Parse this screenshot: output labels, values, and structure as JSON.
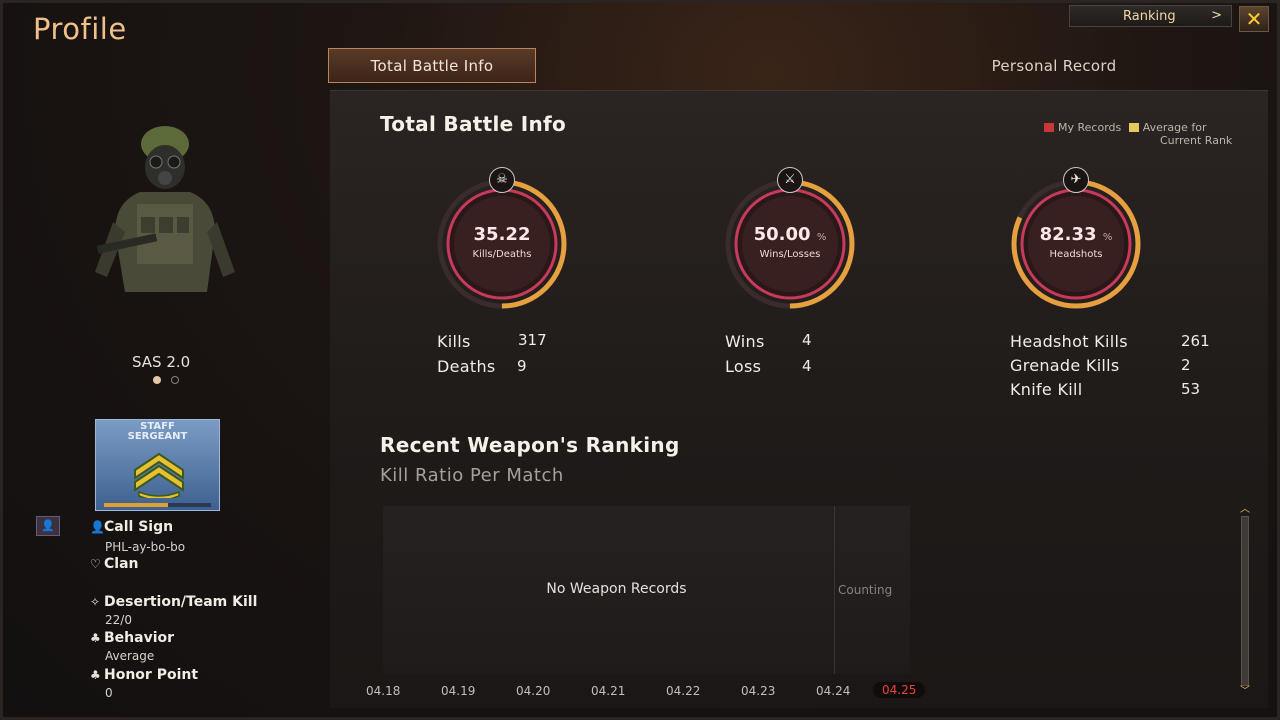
{
  "header": {
    "title": "Profile",
    "ranking_label": "Ranking",
    "ranking_arrow": ">",
    "close_symbol": "✕"
  },
  "tabs": [
    {
      "label": "Total Battle Info",
      "active": true
    },
    {
      "label": "Personal Record",
      "active": false
    }
  ],
  "character": {
    "name": "SAS 2.0",
    "page_count": 2,
    "current_page": 1
  },
  "rank": {
    "title_line1": "STAFF",
    "title_line2": "SERGEANT",
    "progress": 0.6
  },
  "player_info": {
    "call_sign_label": "Call Sign",
    "call_sign": "PHL-ay-bo-bo",
    "clan_label": "Clan",
    "clan": "",
    "desertion_label": "Desertion/Team Kill",
    "desertion": "22/0",
    "behavior_label": "Behavior",
    "behavior": "Average",
    "honor_label": "Honor Point",
    "honor": "0"
  },
  "battle_info": {
    "title": "Total Battle Info",
    "legend": {
      "my_records": "My Records",
      "average_line1": "Average for",
      "average_line2": "Current Rank",
      "my_color": "#c8383a",
      "avg_color": "#e6c860"
    },
    "gauges": [
      {
        "value": "35.22",
        "unit": "",
        "caption": "Kills/Deaths",
        "icon": "skull-icon",
        "fraction": 0.5
      },
      {
        "value": "50.00",
        "unit": "%",
        "caption": "Wins/Losses",
        "icon": "crossed-swords-icon",
        "fraction": 0.5
      },
      {
        "value": "82.33",
        "unit": "%",
        "caption": "Headshots",
        "icon": "rifle-icon",
        "fraction": 0.82
      }
    ],
    "stats": {
      "kills_label": "Kills",
      "kills": "317",
      "deaths_label": "Deaths",
      "deaths": "9",
      "wins_label": "Wins",
      "wins": "4",
      "loss_label": "Loss",
      "loss": "4",
      "headshot_label": "Headshot Kills",
      "headshot": "261",
      "grenade_label": "Grenade Kills",
      "grenade": "2",
      "knife_label": "Knife Kill",
      "knife": "53"
    }
  },
  "weapon_ranking": {
    "title": "Recent Weapon's Ranking",
    "subtitle": "Kill Ratio Per Match",
    "empty_text": "No Weapon Records",
    "counting_text": "Counting",
    "dates": [
      "04.18",
      "04.19",
      "04.20",
      "04.21",
      "04.22",
      "04.23",
      "04.24",
      "04.25"
    ],
    "current_date": "04.25"
  }
}
